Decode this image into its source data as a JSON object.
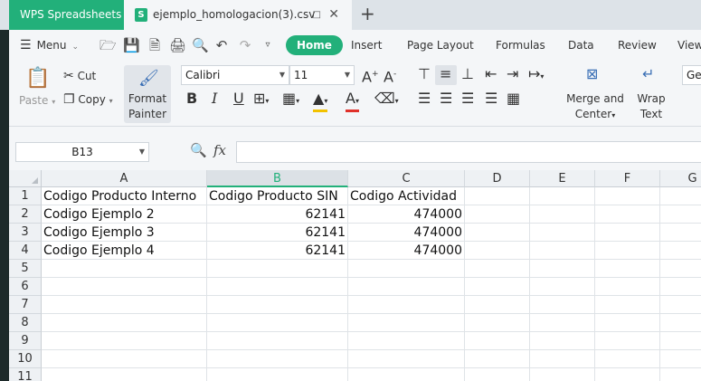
{
  "app": {
    "name": "WPS Spreadsheets",
    "accent": "#22b07a"
  },
  "document_tab": {
    "icon_letter": "S",
    "file_name": "ejemplo_homologacion(3).csv"
  },
  "menubar": {
    "menu_label": "Menu",
    "tabs": [
      "Home",
      "Insert",
      "Page Layout",
      "Formulas",
      "Data",
      "Review",
      "View"
    ],
    "active_tab": "Home"
  },
  "ribbon": {
    "paste": "Paste",
    "cut": "Cut",
    "copy": "Copy",
    "format_painter_line1": "Format",
    "format_painter_line2": "Painter",
    "font_name": "Calibri",
    "font_size": "11",
    "bold": "B",
    "italic": "I",
    "underline": "U",
    "merge_line1": "Merge and",
    "merge_line2": "Center",
    "wrap_line1": "Wrap",
    "wrap_line2": "Text",
    "number_format": "Gen"
  },
  "formula_bar": {
    "cell_ref": "B13",
    "fx": "fx",
    "formula": ""
  },
  "sheet": {
    "columns": [
      "A",
      "B",
      "C",
      "D",
      "E",
      "F",
      "G"
    ],
    "selected_column": "B",
    "rows": [
      {
        "n": "1",
        "a": "Codigo Producto Interno",
        "b": "Codigo Producto SIN",
        "c": "Codigo Actividad"
      },
      {
        "n": "2",
        "a": "Codigo Ejemplo 2",
        "b": "62141",
        "c": "474000"
      },
      {
        "n": "3",
        "a": "Codigo Ejemplo 3",
        "b": "62141",
        "c": "474000"
      },
      {
        "n": "4",
        "a": "Codigo Ejemplo 4",
        "b": "62141",
        "c": "474000"
      },
      {
        "n": "5",
        "a": "",
        "b": "",
        "c": ""
      },
      {
        "n": "6",
        "a": "",
        "b": "",
        "c": ""
      },
      {
        "n": "7",
        "a": "",
        "b": "",
        "c": ""
      },
      {
        "n": "8",
        "a": "",
        "b": "",
        "c": ""
      },
      {
        "n": "9",
        "a": "",
        "b": "",
        "c": ""
      },
      {
        "n": "10",
        "a": "",
        "b": "",
        "c": ""
      },
      {
        "n": "11",
        "a": "",
        "b": "",
        "c": ""
      }
    ]
  }
}
